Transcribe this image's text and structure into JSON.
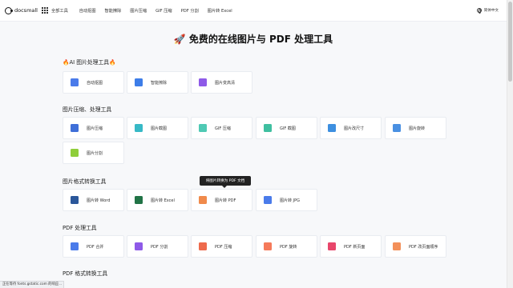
{
  "header": {
    "logo_text": "docsmall",
    "all_tools": "全部工具",
    "nav": [
      "自动抠图",
      "智能擦除",
      "图片压缩",
      "GIF 压缩",
      "PDF 分割",
      "图片转 Excel"
    ],
    "language": "简体中文"
  },
  "hero": {
    "title": "免费的在线图片与 PDF 处理工具"
  },
  "sections": [
    {
      "title": "🔥AI 图片处理工具🔥",
      "items": [
        {
          "label": "自动抠图",
          "icon": "ai-cutout-icon",
          "color": "#4a7bea"
        },
        {
          "label": "智能擦除",
          "icon": "ai-erase-icon",
          "color": "#3d7de8"
        },
        {
          "label": "图片变高清",
          "icon": "ai-upscale-icon",
          "color": "#8e5ae8"
        }
      ]
    },
    {
      "title": "图片压缩、处理工具",
      "items": [
        {
          "label": "图片压缩",
          "icon": "image-compress-icon",
          "color": "#3f6fd8"
        },
        {
          "label": "图片截图",
          "icon": "image-crop-icon",
          "color": "#37b9c6"
        },
        {
          "label": "GIF 压缩",
          "icon": "gif-compress-icon",
          "color": "#4fc9b4"
        },
        {
          "label": "GIF 截图",
          "icon": "gif-crop-icon",
          "color": "#3fbfa0"
        },
        {
          "label": "图片改尺寸",
          "icon": "image-resize-icon",
          "color": "#3d8fe0"
        },
        {
          "label": "图片旋转",
          "icon": "image-rotate-icon",
          "color": "#4a90e2"
        },
        {
          "label": "图片分割",
          "icon": "image-split-icon",
          "color": "#8fce3a"
        }
      ]
    },
    {
      "title": "图片格式转换工具",
      "items": [
        {
          "label": "图片转 Word",
          "icon": "image-to-word-icon",
          "color": "#2b579a"
        },
        {
          "label": "图片转 Excel",
          "icon": "image-to-excel-icon",
          "color": "#217346"
        },
        {
          "label": "图片转 PDF",
          "icon": "image-to-pdf-icon",
          "color": "#f08a4b"
        },
        {
          "label": "图片转 JPG",
          "icon": "image-to-jpg-icon",
          "color": "#4a7bea"
        }
      ]
    },
    {
      "title": "PDF 处理工具",
      "items": [
        {
          "label": "PDF 合并",
          "icon": "pdf-merge-icon",
          "color": "#4a7bea"
        },
        {
          "label": "PDF 分割",
          "icon": "pdf-split-icon",
          "color": "#8e5ae8"
        },
        {
          "label": "PDF 压缩",
          "icon": "pdf-compress-icon",
          "color": "#ee6a4c"
        },
        {
          "label": "PDF 旋转",
          "icon": "pdf-rotate-icon",
          "color": "#f57a5a"
        },
        {
          "label": "PDF 新页面",
          "icon": "pdf-new-page-icon",
          "color": "#e8466b"
        },
        {
          "label": "PDF 改页面顺序",
          "icon": "pdf-reorder-icon",
          "color": "#f3905a"
        }
      ]
    },
    {
      "title": "PDF 格式转换工具",
      "items": []
    }
  ],
  "tooltip": "将图片转换为 PDF 文档",
  "status_bar": "正在等待 fonts.gstatic.com 的响应..."
}
